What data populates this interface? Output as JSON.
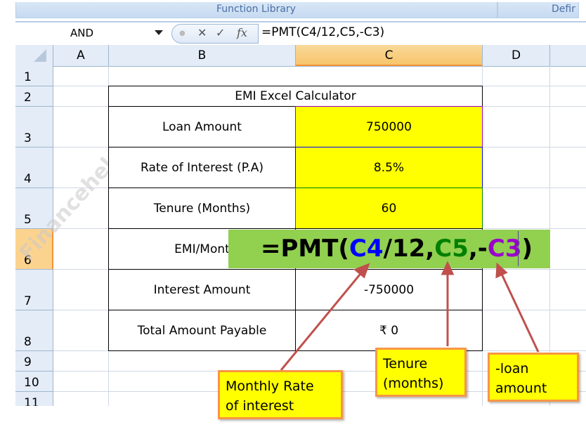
{
  "ribbon": {
    "groups": [
      "Function Library",
      "Defir"
    ]
  },
  "formula_bar": {
    "name_box": "AND",
    "cancel_icon": "✕",
    "enter_icon": "✓",
    "fx_icon": "fx",
    "formula": "=PMT(C4/12,C5,-C3)"
  },
  "columns": [
    "A",
    "B",
    "C",
    "D"
  ],
  "rows": [
    "1",
    "2",
    "3",
    "4",
    "5",
    "6",
    "7",
    "8",
    "9",
    "10",
    "11"
  ],
  "table": {
    "title": "EMI Excel Calculator",
    "rows": [
      {
        "label": "Loan Amount",
        "value": "750000"
      },
      {
        "label": "Rate of Interest (P.A)",
        "value": "8.5%"
      },
      {
        "label": "Tenure (Months)",
        "value": "60"
      },
      {
        "label": "EMI/Mont",
        "value": ""
      },
      {
        "label": "Interest Amount",
        "value": "-750000"
      },
      {
        "label": "Total Amount Payable",
        "value": "₹ 0"
      }
    ]
  },
  "formula_banner": {
    "prefix": "=PMT(",
    "arg1": "C4",
    "mid1": "/12,",
    "arg2": "C5",
    "mid2": ",-",
    "arg3": "C3",
    "suffix": ")",
    "colors": {
      "arg1": "#0000ff",
      "arg2": "#008000",
      "arg3": "#9900cc"
    }
  },
  "callouts": {
    "rate": [
      "Monthly Rate",
      "of interest"
    ],
    "tenure": [
      "Tenure",
      "(months)"
    ],
    "loan": [
      "-loan",
      "amount"
    ]
  },
  "watermark": "Financehelps.in"
}
